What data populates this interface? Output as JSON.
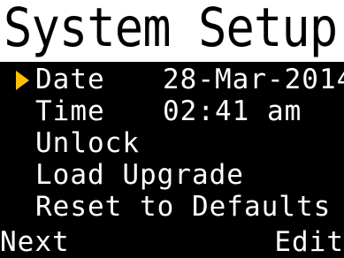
{
  "header": {
    "title": "System Setup"
  },
  "menu": {
    "items": [
      {
        "label": "Date",
        "value": "28-Mar-2014",
        "selected": true
      },
      {
        "label": "Time",
        "value": "02:41 am",
        "selected": false
      },
      {
        "label": "Unlock",
        "value": "",
        "selected": false
      },
      {
        "label": "Load Upgrade",
        "value": "",
        "selected": false
      },
      {
        "label": "Reset to Defaults",
        "value": "",
        "selected": false
      }
    ],
    "cursor_icon": "triangle-right-icon"
  },
  "softkeys": {
    "left": "Next",
    "right": "Edit"
  },
  "colors": {
    "background": "#000000",
    "title_background": "#ffffff",
    "text": "#ffffff",
    "cursor": "#ffc000"
  }
}
